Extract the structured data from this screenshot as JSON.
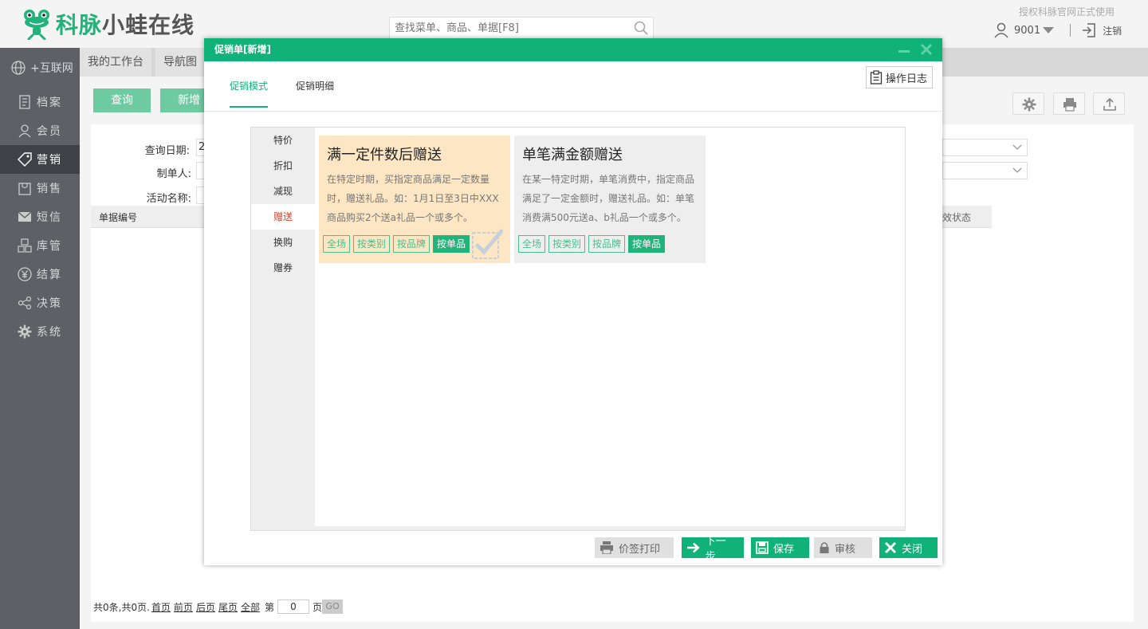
{
  "header": {
    "brand_green": "科脉",
    "brand_gray": "小蛙在线",
    "search_placeholder": "查找菜单、商品、单据[F8]",
    "auth_text": "授权科脉官网正式使用",
    "user": "9001",
    "logout": "注销"
  },
  "sidebar": {
    "items": [
      {
        "label": "+互联网",
        "icon": "globe-icon"
      },
      {
        "label": "档案",
        "icon": "document-icon"
      },
      {
        "label": "会员",
        "icon": "user-icon"
      },
      {
        "label": "营销",
        "icon": "tag-icon"
      },
      {
        "label": "销售",
        "icon": "bag-icon"
      },
      {
        "label": "短信",
        "icon": "mail-icon"
      },
      {
        "label": "库管",
        "icon": "boxes-icon"
      },
      {
        "label": "结算",
        "icon": "yen-icon"
      },
      {
        "label": "决策",
        "icon": "share-icon"
      },
      {
        "label": "系统",
        "icon": "gear-icon"
      }
    ],
    "active_index": 3
  },
  "main": {
    "tabs": [
      "我的工作台",
      "导航图"
    ],
    "query_label": "查询",
    "new_label": "新增",
    "filters": {
      "date_label": "查询日期:",
      "date_value": "2",
      "creator_label": "制单人:",
      "activity_label": "活动名称:"
    },
    "columns": {
      "bill_no": "单据编号",
      "status": "效状态"
    },
    "pager": {
      "summary": "共0条,共0页.",
      "first": "首页",
      "prev": "前页",
      "next": "后页",
      "last": "尾页",
      "all": "全部",
      "page_prefix": "第",
      "page_value": "0",
      "page_suffix": "页",
      "go": "GO"
    }
  },
  "modal": {
    "title": "促销单[新增]",
    "tabs": [
      "促销模式",
      "促销明细"
    ],
    "log_button": "操作日志",
    "left_nav": [
      "特价",
      "折扣",
      "减现",
      "赠送",
      "换购",
      "赠券"
    ],
    "left_nav_active": 3,
    "cards": [
      {
        "title": "满一定件数后赠送",
        "desc": "在特定时期，买指定商品满足一定数量时，赠送礼品。如：1月1日至3日中XXX商品购买2个送a礼品一个或多个。",
        "tags": [
          "全场",
          "按类别",
          "按品牌",
          "按单品"
        ],
        "active_tag": 3,
        "selected": true
      },
      {
        "title": "单笔满金额赠送",
        "desc": "在某一特定时期，单笔消费中，指定商品满足了一定金额时，赠送礼品。如：单笔消费满500元送a、b礼品一个或多个。",
        "tags": [
          "全场",
          "按类别",
          "按品牌",
          "按单品"
        ],
        "active_tag": 3,
        "selected": false
      }
    ],
    "footer": {
      "price_print": "价签打印",
      "next": "下一步",
      "save": "保存",
      "audit": "审核",
      "close": "关闭"
    }
  },
  "colors": {
    "brand_green": "#11b27a",
    "sidebar_bg": "#5e6065",
    "selected_card_bg": "#fde6c3",
    "active_nav_text": "#e0432b"
  }
}
